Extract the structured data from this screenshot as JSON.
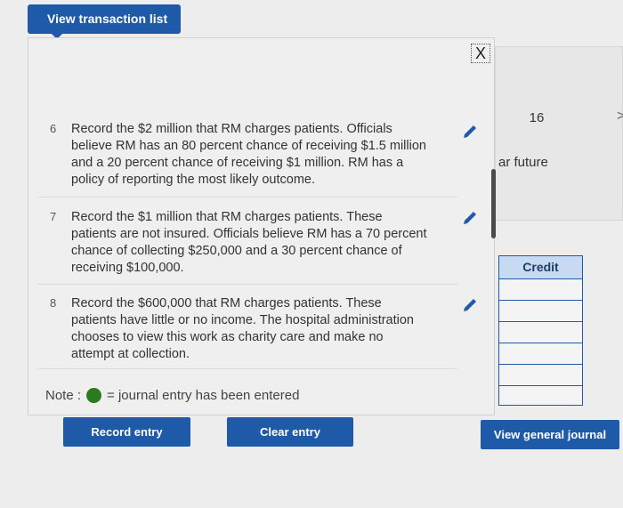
{
  "top_button": {
    "label": "View transaction list"
  },
  "background_panel": {
    "number": "16",
    "text_fragment": "ar future",
    "arrow": ">"
  },
  "modal": {
    "close_symbol": "X",
    "rows": [
      {
        "num": "6",
        "text": "Record the $2 million that RM charges patients. Officials believe RM has an 80 percent chance of receiving $1.5 million and a 20 percent chance of receiving $1 million. RM has a policy of reporting the most likely outcome."
      },
      {
        "num": "7",
        "text": "Record the $1 million that RM charges patients. These patients are not insured. Officials believe RM has a 70 percent chance of collecting $250,000 and a 30 percent chance of receiving $100,000."
      },
      {
        "num": "8",
        "text": "Record the $600,000 that RM charges patients. These patients have little or no income. The hospital administration chooses to view this work as charity care and make no attempt at collection."
      }
    ],
    "note_prefix": "Note :",
    "note_suffix": "= journal entry has been entered",
    "record_label": "Record entry",
    "clear_label": "Clear entry"
  },
  "credit_table": {
    "header": "Credit"
  },
  "view_journal_label": "View general journal",
  "colors": {
    "button_blue": "#1e5aa8",
    "entered_dot": "#2c7a1e",
    "pencil": "#1e5aa8"
  }
}
